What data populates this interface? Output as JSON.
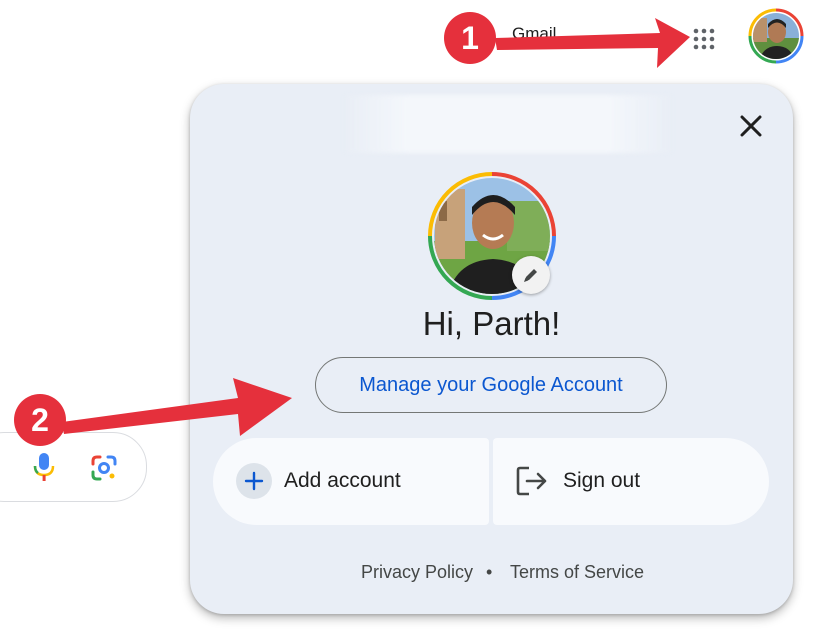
{
  "topbar": {
    "gmail_label": "Gmail",
    "apps_icon": "apps-grid-icon",
    "avatar_icon": "account-avatar-icon"
  },
  "search": {
    "mic_icon": "microphone-icon",
    "lens_icon": "google-lens-icon"
  },
  "account_card": {
    "close_icon": "close-icon",
    "greeting": "Hi, Parth!",
    "manage_label": "Manage your Google Account",
    "add_account_label": "Add account",
    "sign_out_label": "Sign out",
    "privacy_label": "Privacy Policy",
    "separator": "•",
    "terms_label": "Terms of Service"
  },
  "annotations": {
    "step_1": "1",
    "step_2": "2",
    "color": "#e5303c"
  },
  "colors": {
    "card_bg": "#e9eef6",
    "link_blue": "#0b57d0",
    "google_red": "#ea4335",
    "google_yellow": "#fbbc04",
    "google_green": "#34a853",
    "google_blue": "#4285f4"
  }
}
